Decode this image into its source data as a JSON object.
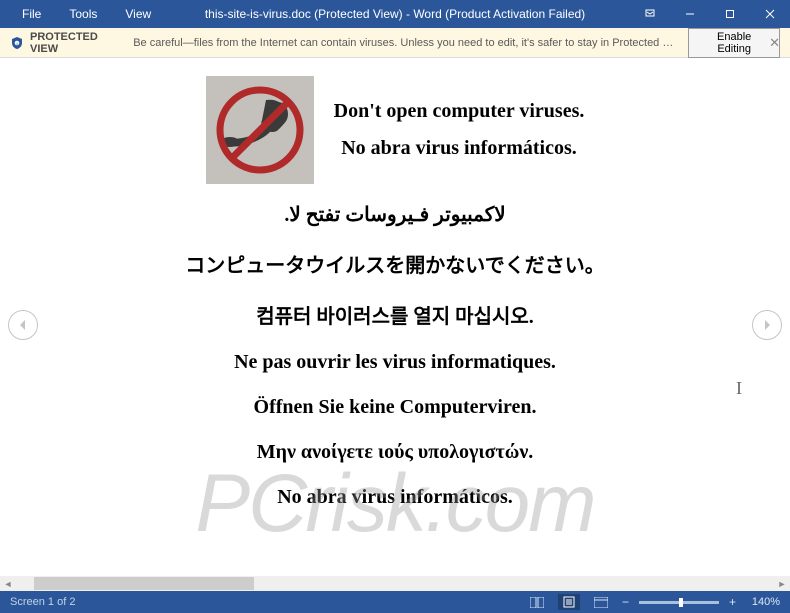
{
  "menu": {
    "file": "File",
    "tools": "Tools",
    "view": "View"
  },
  "title": "this-site-is-virus.doc (Protected View) - Word (Product Activation Failed)",
  "protected_view": {
    "label": "PROTECTED VIEW",
    "text": "Be careful—files from the Internet can contain viruses. Unless you need to edit, it's safer to stay in Protected View.",
    "enable": "Enable Editing"
  },
  "content": {
    "en": "Don't open computer viruses.",
    "es": "No abra virus informáticos.",
    "ar": "لاكمبيوتر فـيروسات تفتح لا.",
    "ja": "コンピュータウイルスを開かないでください。",
    "ko": "컴퓨터 바이러스를 열지 마십시오.",
    "fr": "Ne pas ouvrir les virus informatiques.",
    "de": "Öffnen Sie keine Computerviren.",
    "el": "Μην ανοίγετε ιούς υπολογιστών.",
    "es2": "No abra virus informáticos."
  },
  "status": {
    "page": "Screen 1 of 2",
    "zoom": "140%"
  },
  "watermark": {
    "pc": "PC",
    "risk": "risk",
    "com": ".com"
  }
}
